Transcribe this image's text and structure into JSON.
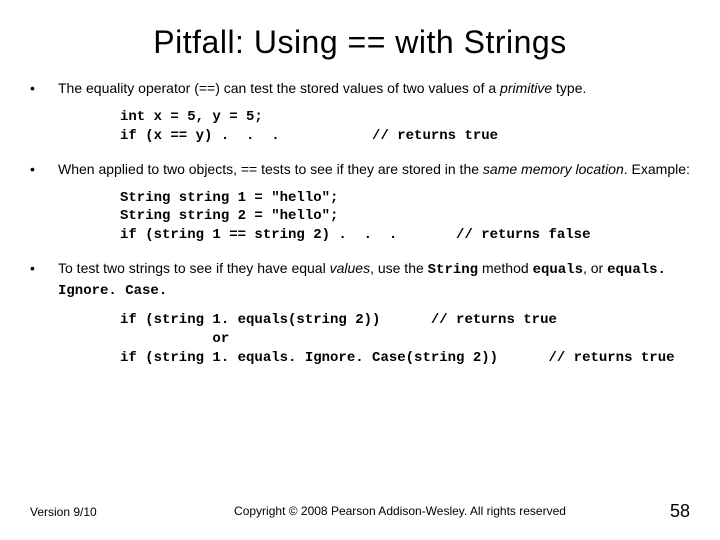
{
  "title": "Pitfall:  Using == with Strings",
  "bullets": [
    {
      "text_html": "The equality operator (==) can test the stored values of two values of a <i>primitive</i> type."
    },
    {
      "text_html": "When applied to two objects, == tests to see if they are stored in the <i>same memory location</i>. Example:"
    },
    {
      "text_html": "To test two strings to see if they have equal <i>values</i>, use the <span class=\"mono-inline\">String</span> method <span class=\"mono-inline\">equals</span>, or <span class=\"mono-inline\">equals. Ignore. Case.</span>"
    }
  ],
  "code_blocks": [
    "int x = 5, y = 5;\nif (x == y) .  .  .           // returns true",
    "String string 1 = \"hello\";\nString string 2 = \"hello\";\nif (string 1 == string 2) .  .  .       // returns false",
    "if (string 1. equals(string 2))      // returns true\n           or\nif (string 1. equals. Ignore. Case(string 2))      // returns true"
  ],
  "footer": {
    "version": "Version 9/10",
    "copyright": "Copyright © 2008 Pearson Addison-Wesley.\nAll rights reserved",
    "page": "58"
  }
}
